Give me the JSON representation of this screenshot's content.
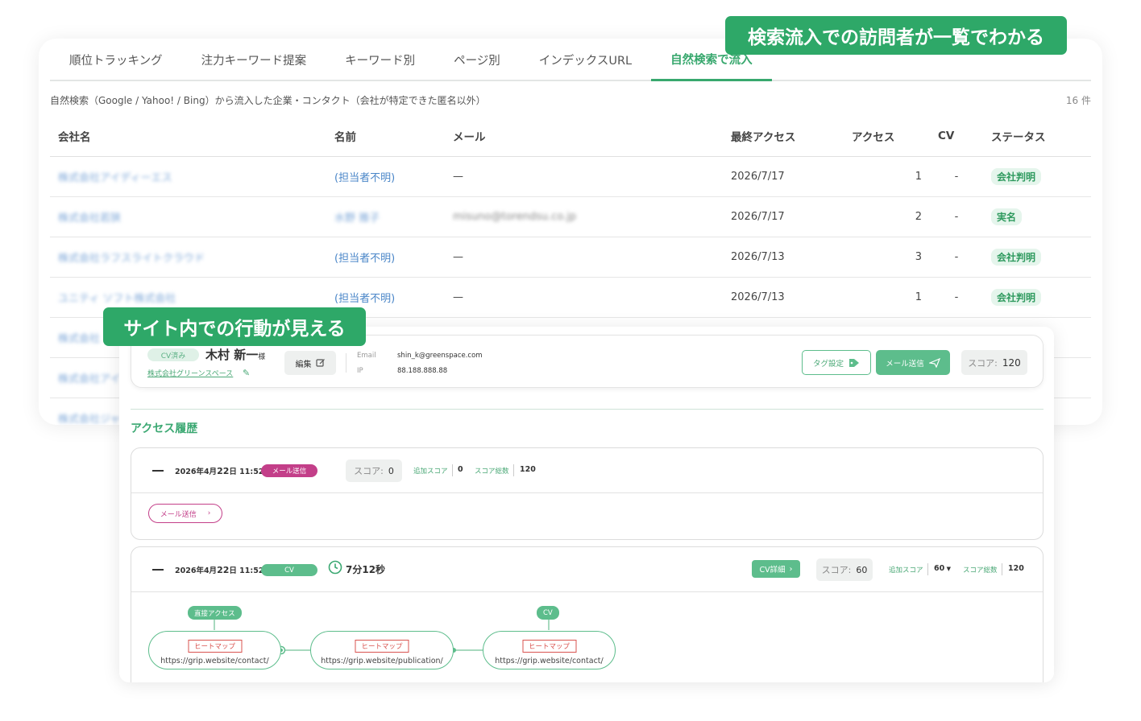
{
  "callouts": {
    "top": "検索流入での訪問者が一覧でわかる",
    "middle": "サイト内での行動が見える"
  },
  "tabs": [
    {
      "label": "順位トラッキング"
    },
    {
      "label": "注力キーワード提案"
    },
    {
      "label": "キーワード別"
    },
    {
      "label": "ページ別"
    },
    {
      "label": "インデックスURL"
    },
    {
      "label": "自然検索で流入"
    }
  ],
  "list": {
    "description": "自然検索（Google / Yahoo! / Bing）から流入した企業・コンタクト（会社が特定できた匿名以外）",
    "count": "16 件",
    "headers": {
      "company": "会社名",
      "name": "名前",
      "email": "メール",
      "last_access": "最終アクセス",
      "access": "アクセス",
      "cv": "CV",
      "status": "ステータス"
    },
    "rows": [
      {
        "company": "株式会社アイディーエス",
        "name": "(担当者不明)",
        "email": "—",
        "last_access": "2026/7/17",
        "access": "1",
        "cv": "-",
        "status": "会社判明"
      },
      {
        "company": "株式会社若狭",
        "name": "水野 雅子",
        "email": "misuno@torendsu.co.jp",
        "last_access": "2026/7/17",
        "access": "2",
        "cv": "-",
        "status": "実名"
      },
      {
        "company": "株式会社ラフスライトクラウド",
        "name": "(担当者不明)",
        "email": "—",
        "last_access": "2026/7/13",
        "access": "3",
        "cv": "-",
        "status": "会社判明"
      },
      {
        "company": "ユニティ ソフト株式会社",
        "name": "(担当者不明)",
        "email": "—",
        "last_access": "2026/7/13",
        "access": "1",
        "cv": "-",
        "status": "会社判明"
      },
      {
        "company": "株式会社",
        "name": "",
        "email": "",
        "last_access": "",
        "access": "",
        "cv": "",
        "status": ""
      },
      {
        "company": "株式会社アイ",
        "name": "",
        "email": "",
        "last_access": "",
        "access": "",
        "cv": "",
        "status": ""
      },
      {
        "company": "株式会社ジャ",
        "name": "",
        "email": "",
        "last_access": "",
        "access": "",
        "cv": "",
        "status": ""
      }
    ]
  },
  "person": {
    "cv_badge": "CV済み",
    "name": "木村 新一",
    "suffix": "様",
    "company": "株式会社グリーンスペース",
    "edit_label": "編集",
    "email_label": "Email",
    "email": "shin_k@greenspace.com",
    "ip_label": "IP",
    "ip": "88.188.888.88",
    "tag_label": "タグ設定",
    "mail_label": "メール送信",
    "score_label": "スコア:",
    "score": "120"
  },
  "history": {
    "title": "アクセス履歴",
    "entry1": {
      "date_prefix": "2026年4月",
      "date_day": "22",
      "date_suffix": "日 11:52",
      "badge": "メール送信",
      "score_label": "スコア:",
      "score": "0",
      "add_label": "追加スコア",
      "add_value": "0",
      "total_label": "スコア総数",
      "total_value": "120",
      "mail_action": "メール送信"
    },
    "entry2": {
      "date_prefix": "2026年4月",
      "date_day": "22",
      "date_suffix": "日 11:52",
      "badge": "CV",
      "duration": "7分12秒",
      "cv_detail": "CV詳細",
      "score_label": "スコア:",
      "score": "60",
      "add_label": "追加スコア",
      "add_value": "60",
      "total_label": "スコア総数",
      "total_value": "120",
      "flow": [
        {
          "top": "直接アクセス",
          "tag": "ヒートマップ",
          "url": "https://grip.website/contact/"
        },
        {
          "top": "",
          "tag": "ヒートマップ",
          "url": "https://grip.website/publication/"
        },
        {
          "top": "CV",
          "tag": "ヒートマップ",
          "url": "https://grip.website/contact/"
        }
      ]
    }
  },
  "colors": {
    "accent": "#2ea868",
    "mail": "#c33f89",
    "heatmap": "#d9534f"
  }
}
